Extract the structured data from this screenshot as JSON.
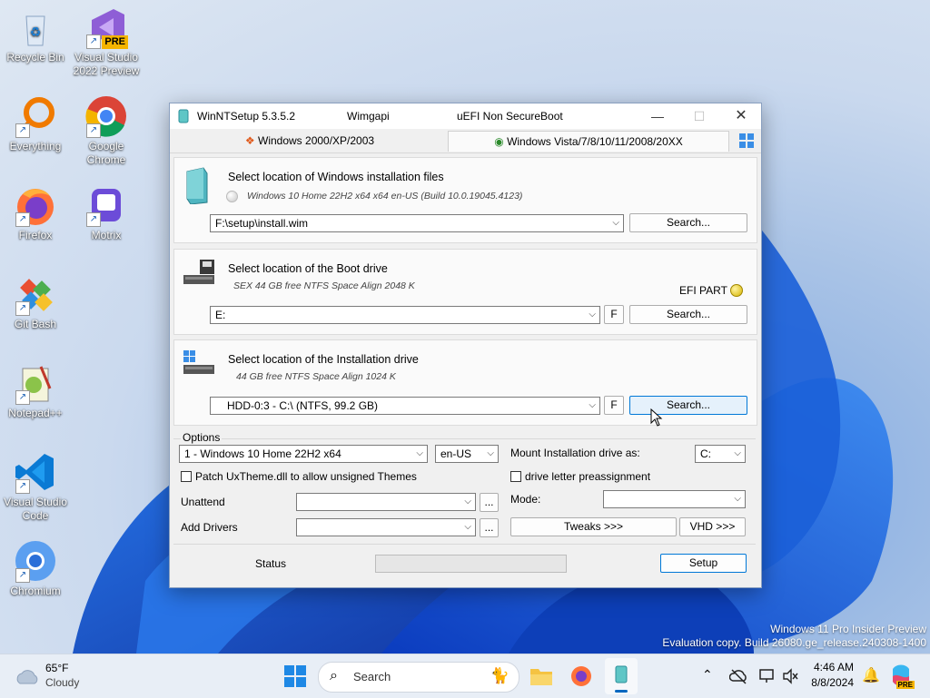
{
  "desktop": {
    "icons": [
      {
        "label": "Recycle Bin"
      },
      {
        "label": "Visual Studio 2022 Preview"
      },
      {
        "label": "Everything"
      },
      {
        "label": "Google Chrome"
      },
      {
        "label": "Firefox"
      },
      {
        "label": "Motrix"
      },
      {
        "label": "Git Bash"
      },
      {
        "label": "Notepad++"
      },
      {
        "label": "Visual Studio Code"
      },
      {
        "label": "Chromium"
      }
    ],
    "pre_badge": "PRE",
    "watermark_line1": "Windows 11 Pro Insider Preview",
    "watermark_line2": "Evaluation copy. Build 26080.ge_release.240308-1400"
  },
  "window": {
    "title": "WinNTSetup 5.3.5.2",
    "wimgapi": "Wimgapi",
    "boot_mode": "uEFI Non SecureBoot",
    "tabs": [
      "Windows 2000/XP/2003",
      "Windows Vista/7/8/10/11/2008/20XX"
    ],
    "section1": {
      "title": "Select location of Windows installation files",
      "info": "Windows 10 Home 22H2 x64  x64 en-US (Build 10.0.19045.4123)",
      "value": "F:\\setup\\install.wim",
      "search": "Search..."
    },
    "section2": {
      "title": "Select location of the Boot drive",
      "info": "SEX 44 GB free NTFS Space Align 2048 K",
      "efi": "EFI PART",
      "value": "E:",
      "f_label": "F",
      "search": "Search..."
    },
    "section3": {
      "title": "Select location of the Installation drive",
      "info": "44 GB free NTFS Space Align 1024 K",
      "value": "HDD-0:3 - C:\\  (NTFS, 99.2 GB)",
      "f_label": "F",
      "search": "Search..."
    },
    "options": {
      "legend": "Options",
      "edition": "1 - Windows 10 Home 22H2 x64",
      "language": "en-US",
      "mount_label": "Mount Installation drive as:",
      "mount_value": "C:",
      "patch_label": "Patch UxTheme.dll to allow unsigned Themes",
      "preassign_label": "drive letter preassignment",
      "unattend_label": "Unattend",
      "mode_label": "Mode:",
      "drivers_label": "Add Drivers",
      "ellipsis": "...",
      "tweaks": "Tweaks >>>",
      "vhd": "VHD >>>"
    },
    "status_label": "Status",
    "setup": "Setup"
  },
  "taskbar": {
    "weather_temp": "65°F",
    "weather_desc": "Cloudy",
    "search_placeholder": "Search",
    "time": "4:46 AM",
    "date": "8/8/2024",
    "copilot_badge": "PRE"
  }
}
